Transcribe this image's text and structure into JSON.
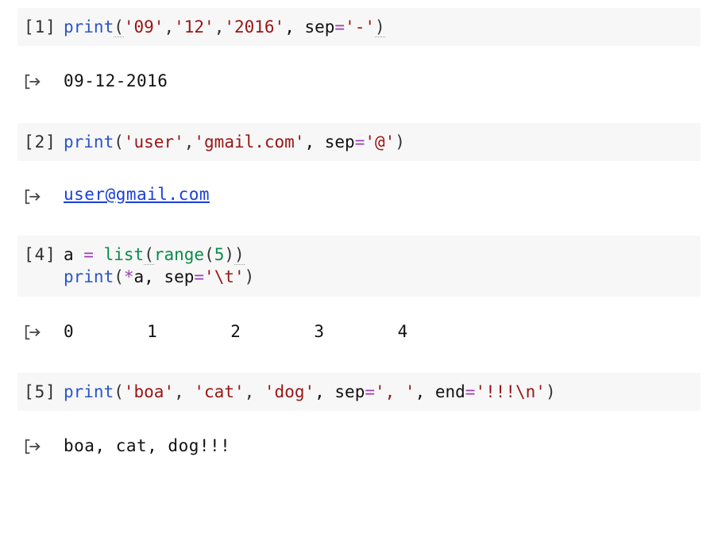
{
  "cells": [
    {
      "prompt": "[1]",
      "code": {
        "tokens": [
          {
            "t": "print",
            "c": "tk-func"
          },
          {
            "t": "(",
            "c": "tk-punc dotted"
          },
          {
            "t": "'09'",
            "c": "tk-str"
          },
          {
            "t": ",",
            "c": "tk-punc"
          },
          {
            "t": "'12'",
            "c": "tk-str"
          },
          {
            "t": ",",
            "c": "tk-punc"
          },
          {
            "t": "'2016'",
            "c": "tk-str"
          },
          {
            "t": ", sep",
            "c": "tk-name"
          },
          {
            "t": "=",
            "c": "tk-op"
          },
          {
            "t": "'-'",
            "c": "tk-str"
          },
          {
            "t": ")",
            "c": "tk-punc dotted"
          }
        ]
      },
      "output_kind": "plain",
      "output": "09-12-2016"
    },
    {
      "prompt": "[2]",
      "code": {
        "tokens": [
          {
            "t": "print",
            "c": "tk-func"
          },
          {
            "t": "(",
            "c": "tk-punc"
          },
          {
            "t": "'user'",
            "c": "tk-str"
          },
          {
            "t": ",",
            "c": "tk-punc"
          },
          {
            "t": "'gmail.com'",
            "c": "tk-str"
          },
          {
            "t": ", sep",
            "c": "tk-name"
          },
          {
            "t": "=",
            "c": "tk-op"
          },
          {
            "t": "'@'",
            "c": "tk-str"
          },
          {
            "t": ")",
            "c": "tk-punc"
          }
        ]
      },
      "output_kind": "link",
      "output": "user@gmail.com"
    },
    {
      "prompt": "[4]",
      "code": {
        "tokens": [
          {
            "t": "a ",
            "c": "tk-name"
          },
          {
            "t": "=",
            "c": "tk-op"
          },
          {
            "t": " ",
            "c": "tk-name"
          },
          {
            "t": "list",
            "c": "tk-builtin"
          },
          {
            "t": "(",
            "c": "tk-punc dotted"
          },
          {
            "t": "range",
            "c": "tk-builtin"
          },
          {
            "t": "(",
            "c": "tk-punc"
          },
          {
            "t": "5",
            "c": "tk-num"
          },
          {
            "t": ")",
            "c": "tk-punc"
          },
          {
            "t": ")",
            "c": "tk-punc dotted"
          },
          {
            "t": "\n",
            "c": ""
          },
          {
            "t": "print",
            "c": "tk-func"
          },
          {
            "t": "(",
            "c": "tk-punc"
          },
          {
            "t": "*",
            "c": "tk-op"
          },
          {
            "t": "a, sep",
            "c": "tk-name"
          },
          {
            "t": "=",
            "c": "tk-op"
          },
          {
            "t": "'\\t'",
            "c": "tk-str"
          },
          {
            "t": ")",
            "c": "tk-punc"
          }
        ]
      },
      "output_kind": "plain",
      "output": "0       1       2       3       4"
    },
    {
      "prompt": "[5]",
      "code": {
        "tokens": [
          {
            "t": "print",
            "c": "tk-func"
          },
          {
            "t": "(",
            "c": "tk-punc"
          },
          {
            "t": "'boa'",
            "c": "tk-str"
          },
          {
            "t": ", ",
            "c": "tk-punc"
          },
          {
            "t": "'cat'",
            "c": "tk-str"
          },
          {
            "t": ", ",
            "c": "tk-punc"
          },
          {
            "t": "'dog'",
            "c": "tk-str"
          },
          {
            "t": ", sep",
            "c": "tk-name"
          },
          {
            "t": "=",
            "c": "tk-op"
          },
          {
            "t": "', '",
            "c": "tk-str"
          },
          {
            "t": ", end",
            "c": "tk-name"
          },
          {
            "t": "=",
            "c": "tk-op"
          },
          {
            "t": "'!!!\\n'",
            "c": "tk-str"
          },
          {
            "t": ")",
            "c": "tk-punc"
          }
        ]
      },
      "output_kind": "plain",
      "output": "boa, cat, dog!!!"
    }
  ]
}
